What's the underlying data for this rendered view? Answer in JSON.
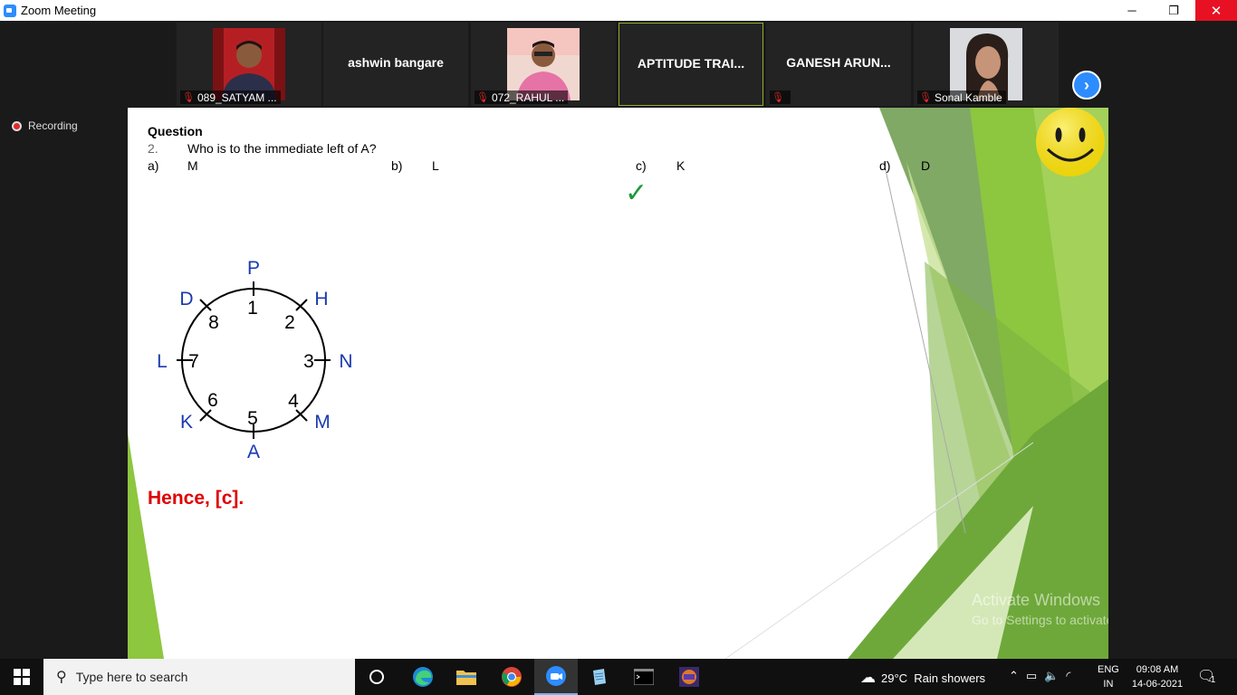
{
  "window": {
    "title": "Zoom Meeting",
    "minimize": "─",
    "maximize": "❐",
    "close": "✕"
  },
  "participants": [
    {
      "name": "089_SATYAM ...",
      "muted": true
    },
    {
      "name": "ashwin bangare"
    },
    {
      "name": "072_RAHUL ...",
      "muted": true
    },
    {
      "name": "APTITUDE TRAI..."
    },
    {
      "name": "GANESH ARUN..."
    },
    {
      "name": "Sonal Kamble",
      "muted": true
    }
  ],
  "recording_label": "Recording",
  "slide": {
    "heading": "Question",
    "number": "2.",
    "question": "Who is to the immediate left of A?",
    "options": [
      {
        "key": "a)",
        "value": "M"
      },
      {
        "key": "b)",
        "value": "L"
      },
      {
        "key": "c)",
        "value": "K"
      },
      {
        "key": "d)",
        "value": "D"
      }
    ],
    "correct_mark": "✓",
    "diagram": {
      "outer_labels": [
        "P",
        "H",
        "N",
        "M",
        "A",
        "K",
        "L",
        "D"
      ],
      "inner_numbers": [
        "1",
        "2",
        "3",
        "4",
        "5",
        "6",
        "7",
        "8"
      ]
    },
    "answer": "Hence, [c]."
  },
  "watermark": {
    "line1": "Activate Windows",
    "line2": "Go to Settings to activate Windows."
  },
  "taskbar": {
    "search_placeholder": "Type here to search",
    "weather": "29°C  Rain showers",
    "lang_line1": "ENG",
    "lang_line2": "IN",
    "time": "09:08 AM",
    "date": "14-06-2021",
    "notification_count": "1"
  }
}
